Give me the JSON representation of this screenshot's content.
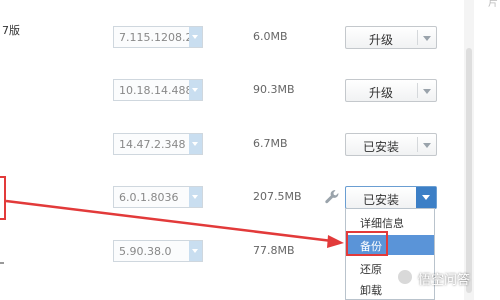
{
  "partial_label": "7版",
  "corner_text": "片",
  "rows": [
    {
      "version": "7.115.1208.2",
      "size": "6.0MB",
      "action": "升级"
    },
    {
      "version": "10.18.14.488",
      "size": "90.3MB",
      "action": "升级"
    },
    {
      "version": "14.47.2.348",
      "size": "6.7MB",
      "action": "已安装"
    },
    {
      "version": "6.0.1.8036",
      "size": "207.5MB",
      "action": "已安装"
    },
    {
      "version": "5.90.38.0",
      "size": "77.8MB"
    }
  ],
  "dropdown_menu": {
    "items": [
      "详细信息",
      "备份",
      "还原",
      "卸载"
    ],
    "selected": "备份"
  },
  "watermark": {
    "text": "悟空问答"
  },
  "colors": {
    "annotation": "#e23a3a",
    "menu_selected": "#5a94d8",
    "dropdown_active": "#3c7fc6",
    "version_arrow": "#c9def0"
  },
  "icons": {
    "tool": "wrench-icon",
    "dropdown": "chevron-down-icon"
  }
}
